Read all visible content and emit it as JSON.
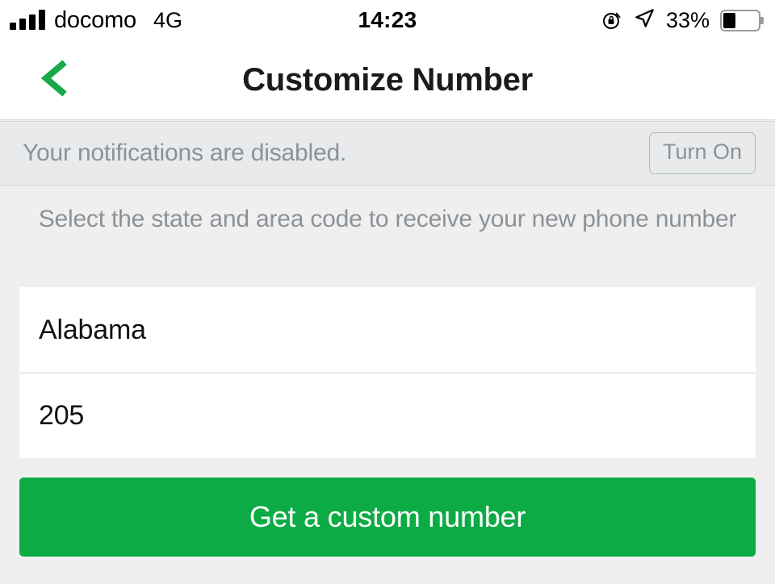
{
  "status_bar": {
    "carrier": "docomo",
    "network": "4G",
    "time": "14:23",
    "battery_percent": "33%",
    "signal_icon": "signal-bars-icon",
    "rotation_lock_icon": "rotation-lock-icon",
    "location_icon": "location-arrow-icon",
    "battery_icon": "battery-icon"
  },
  "nav": {
    "title": "Customize Number",
    "back_icon": "chevron-left-icon"
  },
  "notification_banner": {
    "message": "Your notifications are disabled.",
    "action_label": "Turn On"
  },
  "main": {
    "instruction": "Select the state and area code to receive your new phone number",
    "fields": [
      {
        "name": "state",
        "value": "Alabama"
      },
      {
        "name": "area_code",
        "value": "205"
      }
    ],
    "cta_label": "Get a custom number"
  },
  "colors": {
    "accent_green": "#0cab45",
    "banner_background": "#e8eaec",
    "page_background": "#efefef",
    "muted_text": "#8b9298"
  }
}
